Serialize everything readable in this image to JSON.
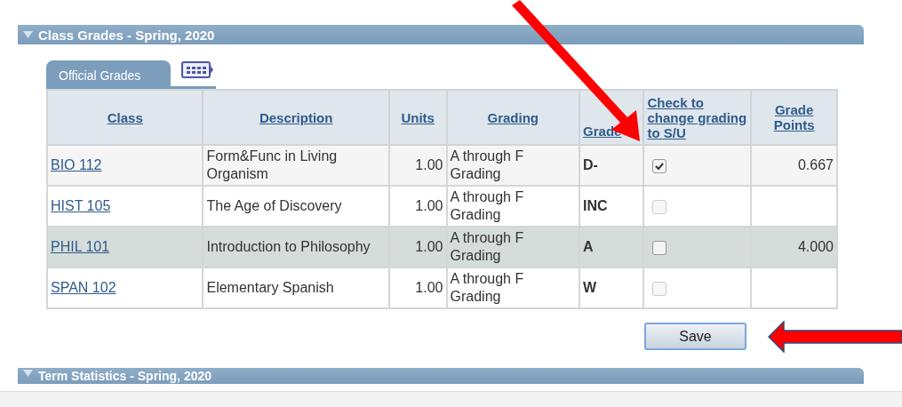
{
  "section": {
    "title": "Class Grades - Spring, 2020",
    "expanded": true
  },
  "tabs": [
    {
      "label": "Official Grades",
      "selected": true
    }
  ],
  "table": {
    "columns": [
      "Class",
      "Description",
      "Units",
      "Grading",
      "Grade",
      "Check to change grading to S/U",
      "Grade Points"
    ],
    "rows": [
      {
        "class": "BIO 112",
        "description": "Form&Func in Living Organism",
        "units": "1.00",
        "grading": "A through F Grading",
        "grade": "D-",
        "checked": true,
        "disabled": false,
        "grade_points": "0.667",
        "highlighted": false
      },
      {
        "class": "HIST 105",
        "description": "The Age of Discovery",
        "units": "1.00",
        "grading": "A through F Grading",
        "grade": "INC",
        "checked": false,
        "disabled": true,
        "highlighted": false
      },
      {
        "class": "PHIL 101",
        "description": "Introduction to Philosophy",
        "units": "1.00",
        "grading": "A through F Grading",
        "grade": "A",
        "checked": false,
        "disabled": false,
        "grade_points": "4.000",
        "highlighted": true
      },
      {
        "class": "SPAN 102",
        "description": "Elementary Spanish",
        "units": "1.00",
        "grading": "A through F Grading",
        "grade": "W",
        "checked": false,
        "disabled": true,
        "highlighted": false
      }
    ]
  },
  "save_button": "Save",
  "next_section": {
    "title": "Term Statistics - Spring, 2020",
    "expanded": true
  }
}
